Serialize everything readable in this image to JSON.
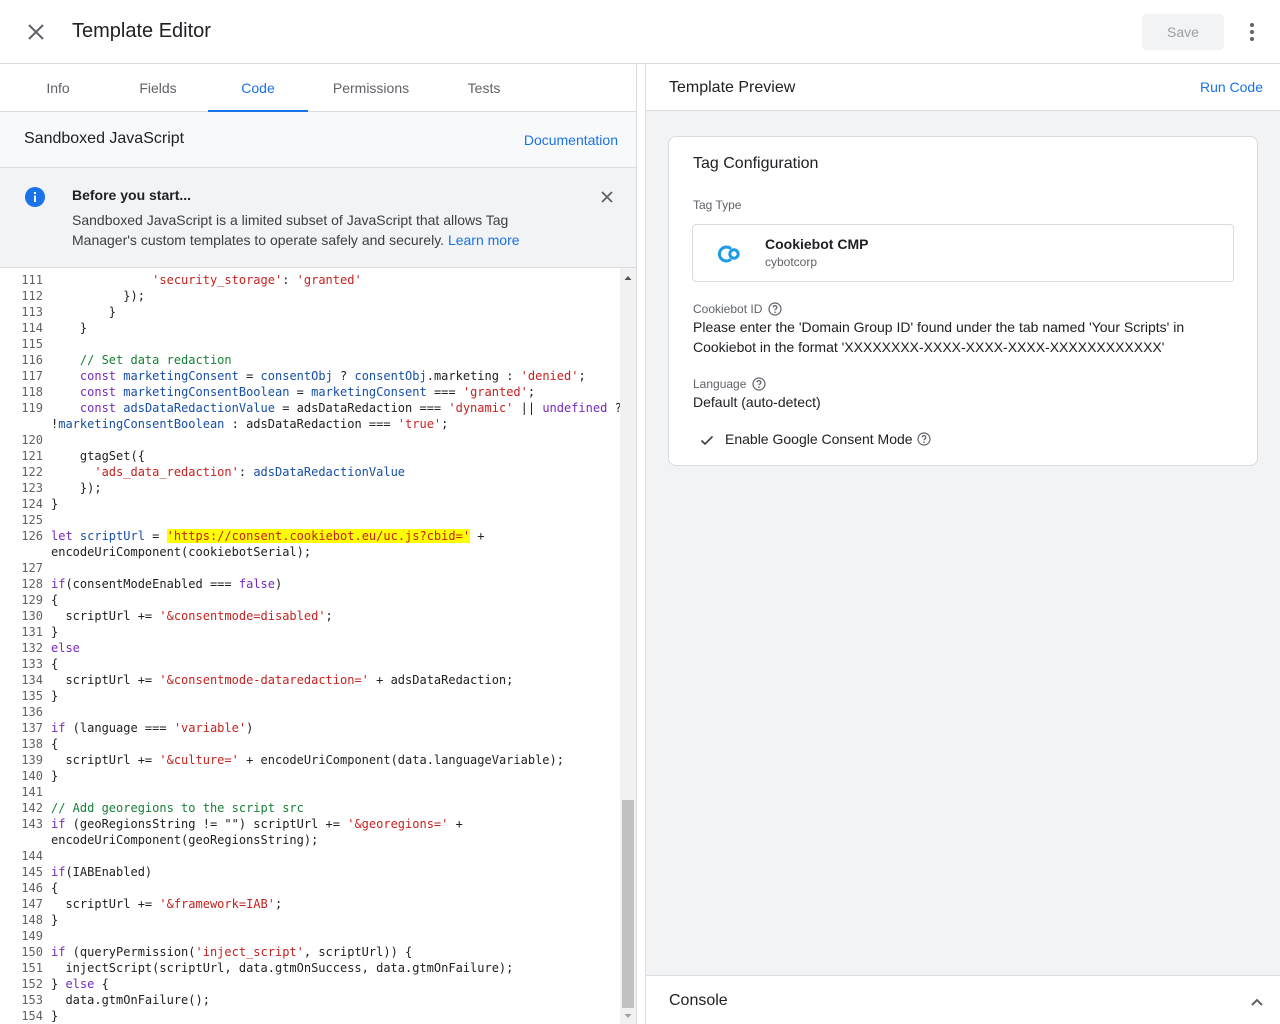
{
  "header": {
    "title": "Template Editor",
    "save_label": "Save"
  },
  "tabs": [
    {
      "label": "Info"
    },
    {
      "label": "Fields"
    },
    {
      "label": "Code"
    },
    {
      "label": "Permissions"
    },
    {
      "label": "Tests"
    }
  ],
  "code_panel": {
    "title": "Sandboxed JavaScript",
    "doc_link": "Documentation",
    "notice_title": "Before you start...",
    "notice_body": "Sandboxed JavaScript is a limited subset of JavaScript that allows Tag Manager's custom templates to operate safely and securely.",
    "notice_link": "Learn more"
  },
  "code_lines": [
    {
      "n": "111",
      "t": [
        [
          "p",
          "              "
        ],
        [
          "s",
          "'security_storage'"
        ],
        [
          "p",
          ": "
        ],
        [
          "s",
          "'granted'"
        ]
      ]
    },
    {
      "n": "112",
      "t": [
        [
          "p",
          "          });"
        ]
      ]
    },
    {
      "n": "113",
      "t": [
        [
          "p",
          "        }"
        ]
      ]
    },
    {
      "n": "114",
      "t": [
        [
          "p",
          "    }"
        ]
      ]
    },
    {
      "n": "115",
      "t": []
    },
    {
      "n": "116",
      "t": [
        [
          "c",
          "    // Set data redaction"
        ]
      ]
    },
    {
      "n": "117",
      "t": [
        [
          "p",
          "    "
        ],
        [
          "k",
          "const "
        ],
        [
          "v",
          "marketingConsent"
        ],
        [
          "p",
          " = "
        ],
        [
          "v",
          "consentObj"
        ],
        [
          "p",
          " ? "
        ],
        [
          "v",
          "consentObj"
        ],
        [
          "p",
          ".marketing : "
        ],
        [
          "s",
          "'denied'"
        ],
        [
          "p",
          ";"
        ]
      ]
    },
    {
      "n": "118",
      "t": [
        [
          "p",
          "    "
        ],
        [
          "k",
          "const "
        ],
        [
          "v",
          "marketingConsentBoolean"
        ],
        [
          "p",
          " = "
        ],
        [
          "v",
          "marketingConsent"
        ],
        [
          "p",
          " === "
        ],
        [
          "s",
          "'granted'"
        ],
        [
          "p",
          ";"
        ]
      ]
    },
    {
      "n": "119",
      "t": [
        [
          "p",
          "    "
        ],
        [
          "k",
          "const "
        ],
        [
          "v",
          "adsDataRedactionValue"
        ],
        [
          "p",
          " = adsDataRedaction === "
        ],
        [
          "s",
          "'dynamic'"
        ],
        [
          "p",
          " || "
        ],
        [
          "k",
          "undefined"
        ],
        [
          "p",
          " ?"
        ]
      ]
    },
    {
      "n": "",
      "t": [
        [
          "p",
          "!"
        ],
        [
          "v",
          "marketingConsentBoolean"
        ],
        [
          "p",
          " : adsDataRedaction === "
        ],
        [
          "s",
          "'true'"
        ],
        [
          "p",
          ";"
        ]
      ]
    },
    {
      "n": "120",
      "t": []
    },
    {
      "n": "121",
      "t": [
        [
          "p",
          "    gtagSet({"
        ]
      ]
    },
    {
      "n": "122",
      "t": [
        [
          "p",
          "      "
        ],
        [
          "s",
          "'ads_data_redaction'"
        ],
        [
          "p",
          ": "
        ],
        [
          "v",
          "adsDataRedactionValue"
        ]
      ]
    },
    {
      "n": "123",
      "t": [
        [
          "p",
          "    });"
        ]
      ]
    },
    {
      "n": "124",
      "t": [
        [
          "p",
          "}"
        ]
      ]
    },
    {
      "n": "125",
      "t": []
    },
    {
      "n": "126",
      "t": [
        [
          "k",
          "let "
        ],
        [
          "v",
          "scriptUrl"
        ],
        [
          "p",
          " = "
        ],
        [
          "h",
          "'https://consent.cookiebot.eu/uc.js?cbid='"
        ],
        [
          "p",
          " +"
        ]
      ]
    },
    {
      "n": "",
      "t": [
        [
          "p",
          "encodeUriComponent(cookiebotSerial);"
        ]
      ]
    },
    {
      "n": "127",
      "t": []
    },
    {
      "n": "128",
      "t": [
        [
          "k",
          "if"
        ],
        [
          "p",
          "(consentModeEnabled === "
        ],
        [
          "k",
          "false"
        ],
        [
          "p",
          ")"
        ]
      ]
    },
    {
      "n": "129",
      "t": [
        [
          "p",
          "{"
        ]
      ]
    },
    {
      "n": "130",
      "t": [
        [
          "p",
          "  scriptUrl += "
        ],
        [
          "s",
          "'&consentmode=disabled'"
        ],
        [
          "p",
          ";"
        ]
      ]
    },
    {
      "n": "131",
      "t": [
        [
          "p",
          "}"
        ]
      ]
    },
    {
      "n": "132",
      "t": [
        [
          "k",
          "else"
        ]
      ]
    },
    {
      "n": "133",
      "t": [
        [
          "p",
          "{"
        ]
      ]
    },
    {
      "n": "134",
      "t": [
        [
          "p",
          "  scriptUrl += "
        ],
        [
          "s",
          "'&consentmode-dataredaction='"
        ],
        [
          "p",
          " + adsDataRedaction;"
        ]
      ]
    },
    {
      "n": "135",
      "t": [
        [
          "p",
          "}"
        ]
      ]
    },
    {
      "n": "136",
      "t": []
    },
    {
      "n": "137",
      "t": [
        [
          "k",
          "if"
        ],
        [
          "p",
          " (language === "
        ],
        [
          "s",
          "'variable'"
        ],
        [
          "p",
          ")"
        ]
      ]
    },
    {
      "n": "138",
      "t": [
        [
          "p",
          "{"
        ]
      ]
    },
    {
      "n": "139",
      "t": [
        [
          "p",
          "  scriptUrl += "
        ],
        [
          "s",
          "'&culture='"
        ],
        [
          "p",
          " + encodeUriComponent(data.languageVariable);"
        ]
      ]
    },
    {
      "n": "140",
      "t": [
        [
          "p",
          "}"
        ]
      ]
    },
    {
      "n": "141",
      "t": []
    },
    {
      "n": "142",
      "t": [
        [
          "c",
          "// Add georegions to the script src"
        ]
      ]
    },
    {
      "n": "143",
      "t": [
        [
          "k",
          "if"
        ],
        [
          "p",
          " (geoRegionsString != \"\") scriptUrl += "
        ],
        [
          "s",
          "'&georegions='"
        ],
        [
          "p",
          " +"
        ]
      ]
    },
    {
      "n": "",
      "t": [
        [
          "p",
          "encodeUriComponent(geoRegionsString);"
        ]
      ]
    },
    {
      "n": "144",
      "t": []
    },
    {
      "n": "145",
      "t": [
        [
          "k",
          "if"
        ],
        [
          "p",
          "(IABEnabled)"
        ]
      ]
    },
    {
      "n": "146",
      "t": [
        [
          "p",
          "{"
        ]
      ]
    },
    {
      "n": "147",
      "t": [
        [
          "p",
          "  scriptUrl += "
        ],
        [
          "s",
          "'&framework=IAB'"
        ],
        [
          "p",
          ";"
        ]
      ]
    },
    {
      "n": "148",
      "t": [
        [
          "p",
          "}"
        ]
      ]
    },
    {
      "n": "149",
      "t": []
    },
    {
      "n": "150",
      "t": [
        [
          "k",
          "if"
        ],
        [
          "p",
          " (queryPermission("
        ],
        [
          "s",
          "'inject_script'"
        ],
        [
          "p",
          ", scriptUrl)) {"
        ]
      ]
    },
    {
      "n": "151",
      "t": [
        [
          "p",
          "  injectScript(scriptUrl, data.gtmOnSuccess, data.gtmOnFailure);"
        ]
      ]
    },
    {
      "n": "152",
      "t": [
        [
          "p",
          "} "
        ],
        [
          "k",
          "else"
        ],
        [
          "p",
          " {"
        ]
      ]
    },
    {
      "n": "153",
      "t": [
        [
          "p",
          "  data.gtmOnFailure();"
        ]
      ]
    },
    {
      "n": "154",
      "t": [
        [
          "p",
          "}"
        ]
      ]
    }
  ],
  "preview": {
    "title": "Template Preview",
    "run_code": "Run Code",
    "card_title": "Tag Configuration",
    "tag_type_label": "Tag Type",
    "tag_name": "Cookiebot CMP",
    "tag_vendor": "cybotcorp",
    "cookiebot_id_label": "Cookiebot ID",
    "cookiebot_id_value": "Please enter the 'Domain Group ID' found under the tab named 'Your Scripts' in Cookiebot in the format 'XXXXXXXX-XXXX-XXXX-XXXX-XXXXXXXXXXXX'",
    "language_label": "Language",
    "language_value": "Default (auto-detect)",
    "consent_mode_label": "Enable Google Consent Mode",
    "console_title": "Console"
  },
  "colors": {
    "accent": "#1a73e8",
    "highlight": "#ffff00"
  }
}
